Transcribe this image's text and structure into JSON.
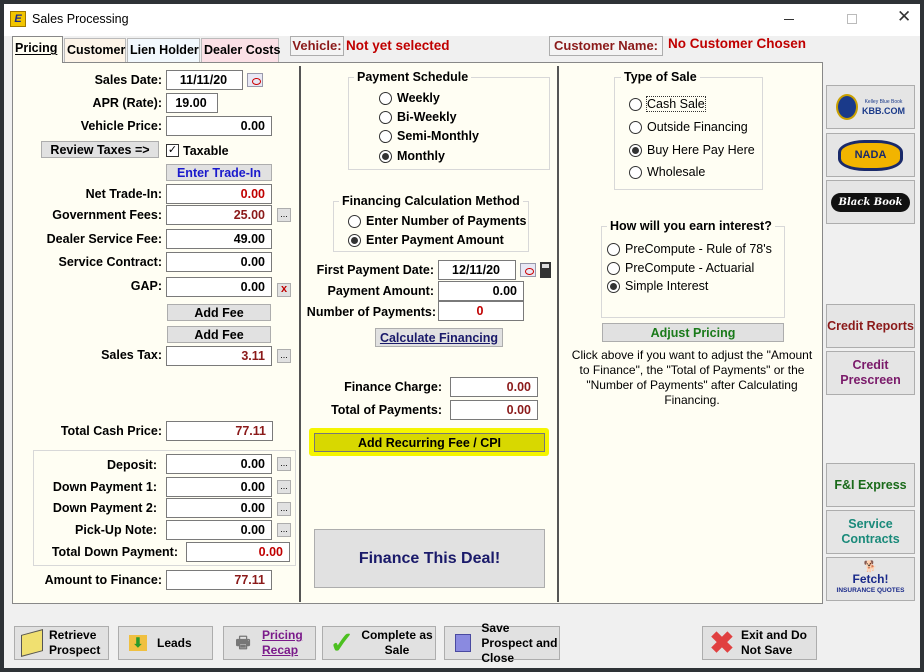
{
  "window": {
    "title": "Sales Processing",
    "app_icon": "ez-logo-icon"
  },
  "tabs": [
    {
      "label": "Pricing",
      "active": true
    },
    {
      "label": "Customer"
    },
    {
      "label": "Lien Holder"
    },
    {
      "label": "Dealer Costs"
    }
  ],
  "header": {
    "vehicle_label": "Vehicle:",
    "vehicle_value": "Not yet selected",
    "customer_label": "Customer Name:",
    "customer_value": "No Customer Chosen"
  },
  "pricing": {
    "sales_date_label": "Sales Date:",
    "sales_date": "11/11/20",
    "apr_label": "APR (Rate):",
    "apr": "19.00",
    "vehicle_price_label": "Vehicle Price:",
    "vehicle_price": "0.00",
    "review_taxes": "Review Taxes =>",
    "taxable_label": "Taxable",
    "taxable": true,
    "enter_trade_in": "Enter Trade-In",
    "net_trade_in_label": "Net Trade-In:",
    "net_trade_in": "0.00",
    "gov_fees_label": "Government Fees:",
    "gov_fees": "25.00",
    "dealer_fee_label": "Dealer Service Fee:",
    "dealer_fee": "49.00",
    "service_contract_label": "Service Contract:",
    "service_contract": "0.00",
    "gap_label": "GAP:",
    "gap": "0.00",
    "add_fee_1": "Add Fee",
    "add_fee_2": "Add Fee",
    "sales_tax_label": "Sales Tax:",
    "sales_tax": "3.11",
    "total_cash_label": "Total Cash Price:",
    "total_cash": "77.11",
    "deposit_label": "Deposit:",
    "deposit": "0.00",
    "dp1_label": "Down Payment 1:",
    "dp1": "0.00",
    "dp2_label": "Down Payment 2:",
    "dp2": "0.00",
    "pickup_label": "Pick-Up Note:",
    "pickup": "0.00",
    "total_down_label": "Total Down Payment:",
    "total_down": "0.00",
    "amount_finance_label": "Amount to Finance:",
    "amount_finance": "77.11",
    "more_label": "...",
    "clear_label": "x"
  },
  "schedule": {
    "title": "Payment Schedule",
    "options": [
      "Weekly",
      "Bi-Weekly",
      "Semi-Monthly",
      "Monthly"
    ],
    "selected": "Monthly"
  },
  "calc_method": {
    "title": "Financing Calculation Method",
    "options": [
      "Enter Number of Payments",
      "Enter Payment Amount"
    ],
    "selected": "Enter Payment Amount"
  },
  "financing": {
    "first_payment_label": "First Payment Date:",
    "first_payment": "12/11/20",
    "payment_amount_label": "Payment Amount:",
    "payment_amount": "0.00",
    "num_payments_label": "Number of Payments:",
    "num_payments": "0",
    "calculate": "Calculate Financing",
    "finance_charge_label": "Finance Charge:",
    "finance_charge": "0.00",
    "total_payments_label": "Total of Payments:",
    "total_payments": "0.00",
    "recurring": "Add Recurring Fee / CPI",
    "finance_deal": "Finance This Deal!"
  },
  "sale_type": {
    "title": "Type of Sale",
    "options": [
      "Cash Sale",
      "Outside Financing",
      "Buy Here Pay Here",
      "Wholesale"
    ],
    "selected": "Buy Here Pay Here"
  },
  "interest": {
    "title": "How will you earn interest?",
    "options": [
      "PreCompute - Rule of 78's",
      "PreCompute - Actuarial",
      "Simple Interest"
    ],
    "selected": "Simple Interest"
  },
  "adjust": {
    "label": "Adjust Pricing",
    "help": "Click above if you want to adjust the \"Amount to Finance\", the \"Total of Payments\" or the \"Number of Payments\" after Calculating Financing."
  },
  "side": {
    "kbb": "KBB.COM",
    "kbb_sub": "Kelley Blue Book",
    "nada": "NADA",
    "blackbook": "Black Book",
    "credit_reports": "Credit Reports",
    "credit_prescreen": "Credit Prescreen",
    "fi_express": "F&I Express",
    "service_contracts": "Service Contracts",
    "fetch": "Fetch!",
    "fetch_sub": "INSURANCE QUOTES"
  },
  "bottom": {
    "retrieve": "Retrieve Prospect",
    "leads": "Leads",
    "recap": "Pricing Recap",
    "complete": "Complete as Sale",
    "save": "Save Prospect and Close",
    "exit": "Exit and Do Not Save"
  },
  "colors": {
    "panel": "#fffef3",
    "accent_red": "#c00000",
    "highlight": "#f5f500"
  }
}
